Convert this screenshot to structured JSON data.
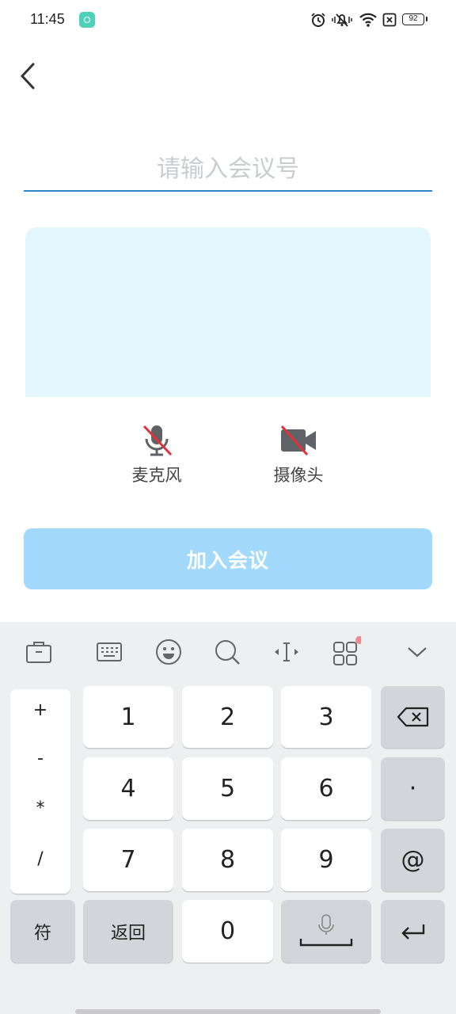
{
  "status_bar": {
    "time": "11:45",
    "battery": "92",
    "icons": [
      "app-notification-icon",
      "alarm-icon",
      "vibrate-icon",
      "wifi-icon",
      "sim-disabled-icon",
      "battery-icon"
    ]
  },
  "header": {
    "back_icon": "chevron-left-icon"
  },
  "meeting_input": {
    "placeholder": "请输入会议号",
    "value": ""
  },
  "preview": {
    "background": "#e3f6fd"
  },
  "controls": {
    "microphone_label": "麦克风",
    "camera_label": "摄像头",
    "muted_color": "#e0323a"
  },
  "join_button": {
    "label": "加入会议",
    "color": "#a2d9fc"
  },
  "keyboard": {
    "toolbar": [
      "toolbox-icon",
      "keyboard-icon",
      "emoji-icon",
      "search-icon",
      "cursor-icon",
      "apps-icon",
      "collapse-icon"
    ],
    "symbols": [
      "+",
      "-",
      "*",
      "/"
    ],
    "rows": [
      [
        "1",
        "2",
        "3"
      ],
      [
        "4",
        "5",
        "6"
      ],
      [
        "7",
        "8",
        "9"
      ]
    ],
    "side_keys": {
      "backspace": "backspace-icon",
      "dot": "·",
      "at": "@",
      "enter": "enter-icon"
    },
    "bottom": {
      "symbols": "符",
      "back": "返回",
      "zero": "0",
      "space": "mic-space-icon"
    }
  }
}
